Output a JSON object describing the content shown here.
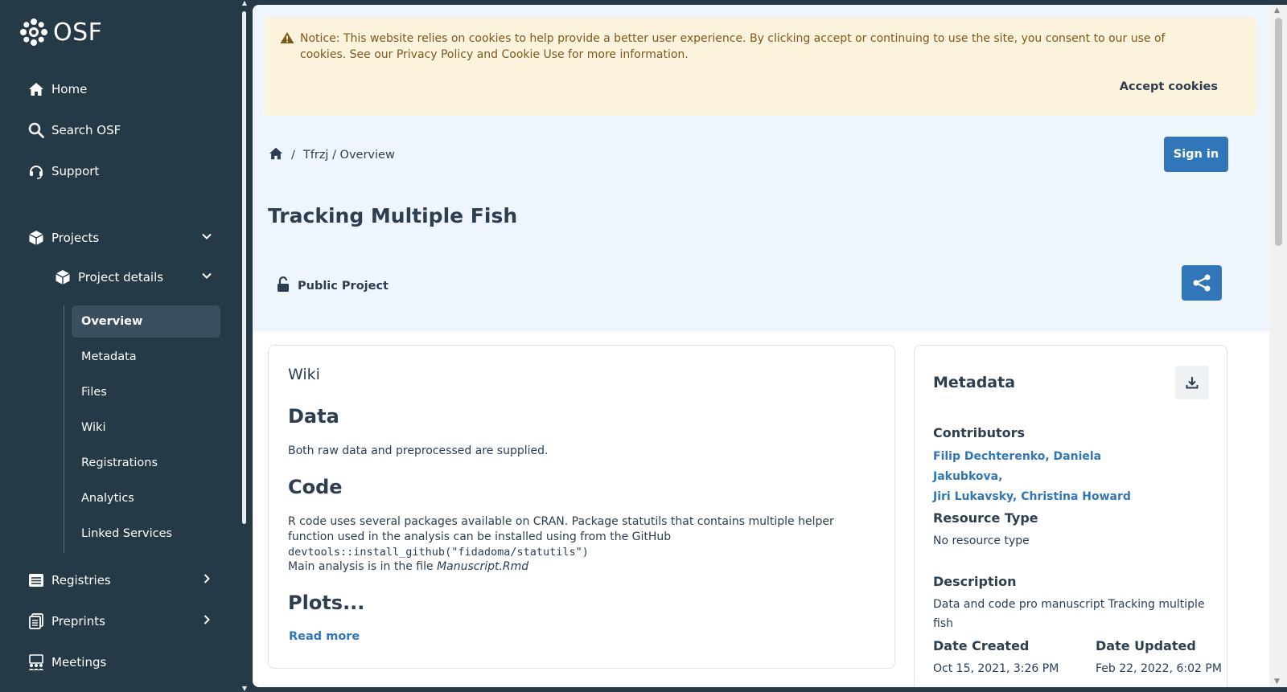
{
  "sidebar": {
    "logo_text": "OSF",
    "nav": {
      "home": "Home",
      "search": "Search OSF",
      "support": "Support",
      "projects": "Projects",
      "project_details": "Project details",
      "registries": "Registries",
      "preprints": "Preprints",
      "meetings": "Meetings"
    },
    "subitems": [
      "Overview",
      "Metadata",
      "Files",
      "Wiki",
      "Registrations",
      "Analytics",
      "Linked Services"
    ]
  },
  "cookie": {
    "message": "Notice: This website relies on cookies to help provide a better user experience. By clicking accept or continuing to use the site, you consent to our use of cookies. See our Privacy Policy and Cookie Use for more information.",
    "accept_label": "Accept cookies"
  },
  "header": {
    "breadcrumb_sep": "/",
    "breadcrumb_path": "Tfrzj / Overview",
    "signin_label": "Sign in",
    "title": "Tracking Multiple Fish",
    "visibility": "Public Project"
  },
  "wiki": {
    "heading": "Wiki",
    "h_data": "Data",
    "p_data": "Both raw data and preprocessed are supplied.",
    "h_code": "Code",
    "p_code_text": "R code uses several packages available on CRAN. Package statutils that contains multiple helper function used in the analysis can be installed using from the GitHub ",
    "p_code_snippet": "devtools::install_github(\"fidadoma/statutils\")",
    "p_main_text": "Main analysis is in the file ",
    "p_main_file": "Manuscript.Rmd",
    "h_plots": "Plots...",
    "read_more": "Read more"
  },
  "metadata": {
    "heading": "Metadata",
    "contributors_label": "Contributors",
    "contributors": [
      "Filip Dechterenko,",
      "Daniela Jakubkova,",
      "Jiri Lukavsky,",
      "Christina Howard"
    ],
    "resource_type_label": "Resource Type",
    "resource_type": "No resource type",
    "description_label": "Description",
    "description": "Data and code pro manuscript Tracking multiple fish",
    "date_created_label": "Date Created",
    "date_created": "Oct 15, 2021, 3:26 PM",
    "date_updated_label": "Date Updated",
    "date_updated": "Feb 22, 2022, 6:02 PM"
  },
  "colors": {
    "sidebar_bg": "#263947",
    "accent": "#2f77b8",
    "hero_bg": "#eef5fc",
    "cookie_bg": "#fcf3dc"
  }
}
